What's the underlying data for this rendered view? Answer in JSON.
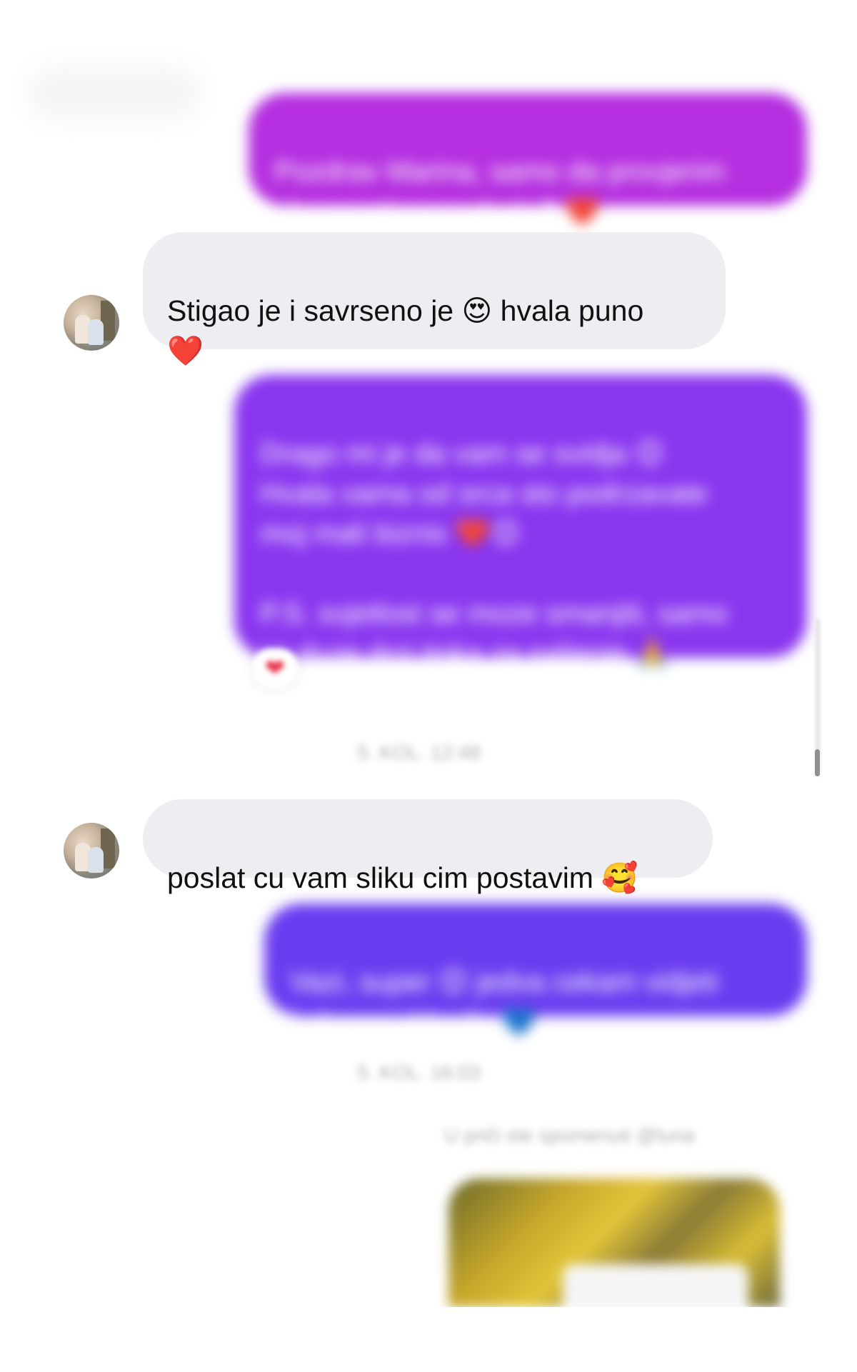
{
  "conversation": {
    "messages": [
      {
        "id": "m1",
        "direction": "outgoing",
        "blurred": true,
        "text": "Pozdrav Marina, samo da provjerim\nal vam stigao paketic? ❤️",
        "color": "#b52fe0"
      },
      {
        "id": "m2",
        "direction": "incoming",
        "blurred": false,
        "text": "Stigao je i savrseno je 😍 hvala puno\n❤️"
      },
      {
        "id": "m3",
        "direction": "outgoing",
        "blurred": true,
        "text": "Drago mi je da vam se svidja 😊\nHvala vama od srca sto podrzavate\nmoj mali biznis ❤️😊\n\nP.S. svjetlost se moze smanjiti, samo\nse duze drzi tipka za paljenje 🙏",
        "color": "#8a36ef",
        "reaction": "❤"
      },
      {
        "id": "ts1",
        "type": "timestamp",
        "text": "5. KOL. 12:48"
      },
      {
        "id": "m4",
        "direction": "incoming",
        "blurred": false,
        "text": "poslat cu vam sliku cim postavim 🥰"
      },
      {
        "id": "m5",
        "direction": "outgoing",
        "blurred": true,
        "text": "Vazi, super 😊 jedva cekam vidjeti\nkako se uklopilo 💙",
        "color": "#6a3cf0"
      },
      {
        "id": "ts2",
        "type": "timestamp",
        "text": "5. KOL. 16:03"
      },
      {
        "id": "mention",
        "type": "mention",
        "text": "U priči ste spomenuti @luna"
      }
    ]
  },
  "icons": {
    "avatar": "contact-avatar-photo",
    "reaction": "heart-icon",
    "media": "story-thumbnail"
  }
}
